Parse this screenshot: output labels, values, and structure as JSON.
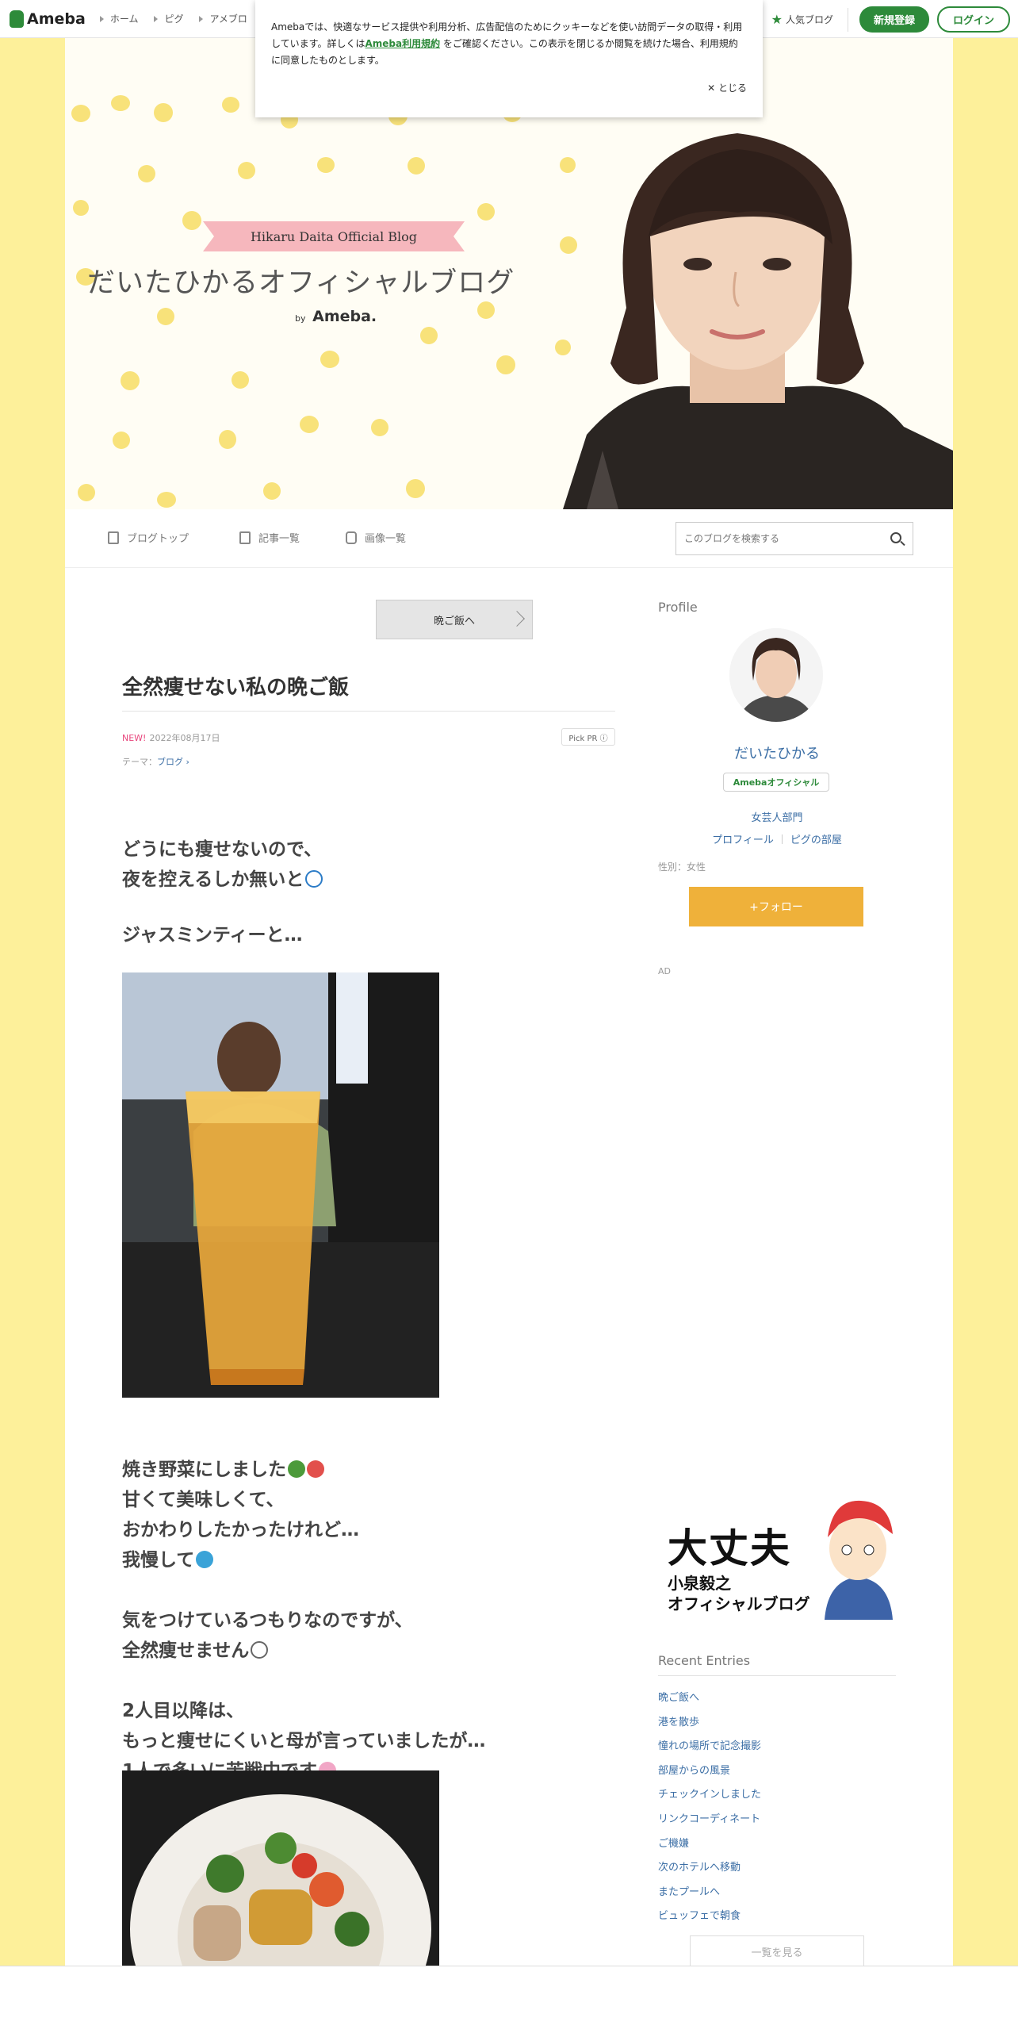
{
  "topbar": {
    "logo": "Ameba",
    "nav": [
      "ホーム",
      "ピグ",
      "アメブロ"
    ],
    "popular": "人気ブログ",
    "register": "新規登録",
    "login": "ログイン"
  },
  "cookie": {
    "text_before": "Amebaでは、快適なサービス提供や利用分析、広告配信のためにクッキーなどを使い訪問データの取得・利用しています。詳しくは",
    "link": "Ameba利用規約",
    "text_after": "をご確認ください。この表示を閉じるか閲覧を続けた場合、利用規約に同意したものとします。",
    "close": "✕ とじる"
  },
  "header": {
    "ribbon": "Hikaru Daita Official Blog",
    "title": "だいたひかるオフィシャルブログ",
    "by": "by",
    "ameba": "Ameba."
  },
  "blognav": {
    "top": "ブログトップ",
    "entries": "記事一覧",
    "images": "画像一覧",
    "search_placeholder": "このブログを検索する"
  },
  "article": {
    "prev": "晩ご飯へ",
    "title": "全然痩せない私の晩ご飯",
    "new": "NEW!",
    "date": "2022年08月17日",
    "pickpr": "Pick PR ⓘ",
    "theme_label": "テーマ：",
    "theme": "ブログ ›",
    "p1a": "どうにも痩せないので、",
    "p1b": "夜を控えるしか無いと",
    "p2": "ジャスミンティーと…",
    "p3a": "焼き野菜にしました",
    "p3b": "甘くて美味しくて、",
    "p3c": "おかわりしたかったけれど…",
    "p3d": "我慢して",
    "p4a": "気をつけているつもりなのですが、",
    "p4b": "全然痩せません",
    "p5a": "2人目以降は、",
    "p5b": "もっと痩せにくいと母が言っていましたが…",
    "p5c": "1人で多いに苦戦中です"
  },
  "sidebar": {
    "profile_head": "Profile",
    "name": "だいたひかる",
    "official": "Amebaオフィシャル",
    "genre": "女芸人部門",
    "profile_link": "プロフィール",
    "pig_link": "ピグの部屋",
    "gender": "性別：女性",
    "follow": "+フォロー",
    "ad": "AD",
    "banner_l1": "大丈夫",
    "banner_l2": "小泉毅之",
    "banner_l3": "オフィシャルブログ",
    "recent_head": "Recent Entries",
    "recent": [
      "晩ご飯へ",
      "港を散歩",
      "憧れの場所で記念撮影",
      "部屋からの風景",
      "チェックインしました",
      "リンクコーディネート",
      "ご機嫌",
      "次のホテルへ移動",
      "またプールへ",
      "ビュッフェで朝食"
    ],
    "more": "一覧を見る"
  }
}
